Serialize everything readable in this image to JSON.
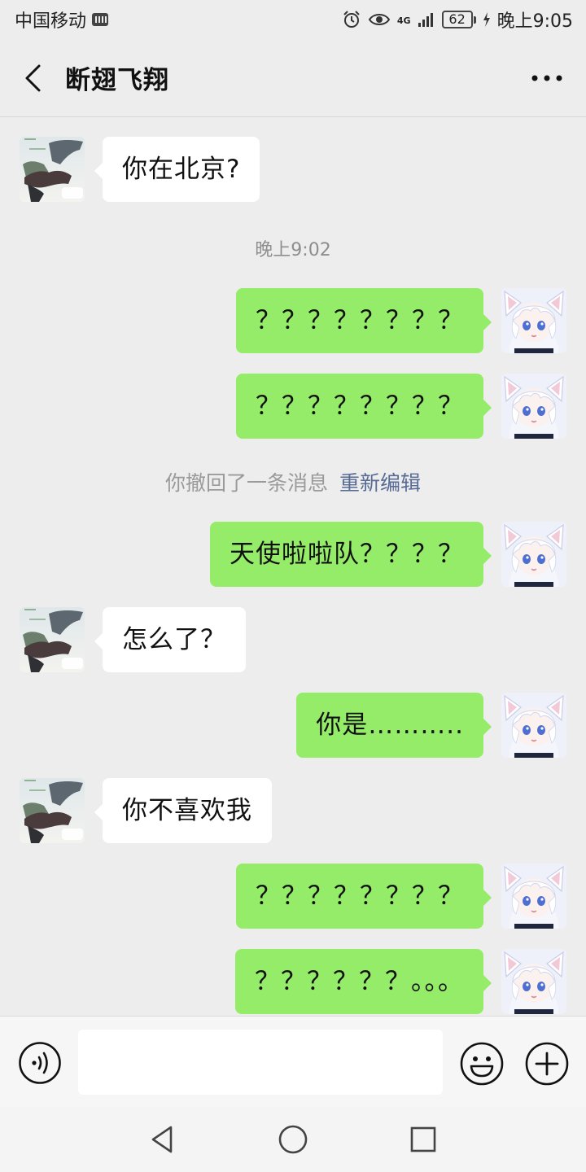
{
  "status_bar": {
    "carrier": "中国移动",
    "network": "4G",
    "battery": "62",
    "time": "晚上9:05"
  },
  "header": {
    "title": "断翅飞翔",
    "back_icon": "chevron-left-icon",
    "more_icon": "more-dots-icon"
  },
  "chat": {
    "timestamp": "晚上9:02",
    "recall_notice": {
      "text": "你撤回了一条消息",
      "action": "重新编辑"
    },
    "messages": [
      {
        "side": "left",
        "text": "你在北京?"
      },
      {
        "side": "right",
        "text": "？？？？？？？？"
      },
      {
        "side": "right",
        "text": "？？？？？？？？"
      },
      {
        "side": "right",
        "text": "天使啦啦队？？？？"
      },
      {
        "side": "left",
        "text": "怎么了？"
      },
      {
        "side": "right",
        "text": "你是……….."
      },
      {
        "side": "left",
        "text": "你不喜欢我"
      },
      {
        "side": "right",
        "text": "？？？？？？？？"
      },
      {
        "side": "right",
        "text": "？？？？？？。。。"
      }
    ]
  },
  "input_bar": {
    "text_value": "",
    "voice_icon": "voice-icon",
    "emoji_icon": "emoji-icon",
    "plus_icon": "plus-icon"
  },
  "nav_bar": {
    "back_icon": "nav-back-icon",
    "home_icon": "nav-home-icon",
    "recents_icon": "nav-recents-icon"
  },
  "colors": {
    "background": "#ededed",
    "sent_bubble": "#95ec69",
    "received_bubble": "#ffffff",
    "link": "#576b95"
  }
}
